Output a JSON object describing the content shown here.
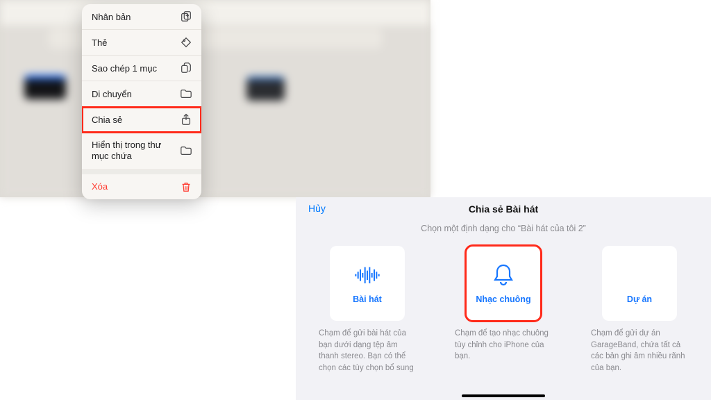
{
  "contextMenu": {
    "items": [
      {
        "label": "Nhân bản",
        "icon": "duplicate"
      },
      {
        "label": "Thẻ",
        "icon": "tag"
      },
      {
        "label": "Sao chép 1 mục",
        "icon": "copy"
      },
      {
        "label": "Di chuyển",
        "icon": "folder"
      },
      {
        "label": "Chia sẻ",
        "icon": "share"
      },
      {
        "label": "Hiển thị trong thư mục chứa",
        "icon": "folder"
      },
      {
        "label": "Xóa",
        "icon": "trash"
      }
    ]
  },
  "shareSheet": {
    "cancel": "Hủy",
    "title": "Chia sẻ Bài hát",
    "subtitle": "Chọn một định dạng cho “Bài hát của tôi 2”",
    "cards": [
      {
        "label": "Bài hát",
        "desc": "Chạm để gửi bài hát của bạn dưới dạng tệp âm thanh stereo. Bạn có thể chọn các tùy chọn bổ sung"
      },
      {
        "label": "Nhạc chuông",
        "desc": "Chạm để tạo nhạc chuông tùy chỉnh cho iPhone của bạn."
      },
      {
        "label": "Dự án",
        "desc": "Chạm để gửi dự án GarageBand, chứa tất cả các bản ghi âm nhiều rãnh của bạn."
      }
    ]
  }
}
